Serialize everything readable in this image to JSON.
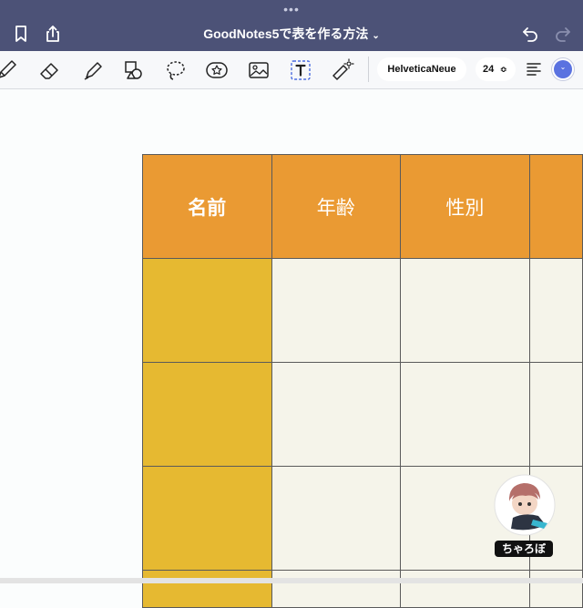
{
  "titlebar": {
    "dots": "•••",
    "title": "GoodNotes5で表を作る方法",
    "title_chevron": "⌄",
    "icons": [
      "bookmark-icon",
      "share-icon",
      "undo-icon",
      "redo-icon"
    ],
    "background": "#4c5277"
  },
  "toolbar": {
    "tools": [
      "pen-icon",
      "eraser-icon",
      "highlighter-icon",
      "shapes-icon",
      "lasso-icon",
      "sticker-icon",
      "image-icon",
      "text-box-icon",
      "laser-pointer-icon"
    ],
    "selected_tool": "text-box-icon",
    "font_name": "HelveticaNeue",
    "font_size": "24",
    "font_size_chevron": "≎",
    "alignment": "align-left-icon",
    "current_color": "#5a72e0"
  },
  "table": {
    "headers": [
      "名前",
      "年齢",
      "性別",
      ""
    ],
    "header_color": "#ea9a33",
    "name_column_color": "#e6b931",
    "cell_color": "#f5f4ea",
    "rows": [
      [
        "",
        "",
        "",
        ""
      ],
      [
        "",
        "",
        "",
        ""
      ],
      [
        "",
        "",
        "",
        ""
      ],
      [
        "",
        "",
        "",
        ""
      ]
    ]
  },
  "watermark": {
    "label": "ちゃろぼ"
  }
}
